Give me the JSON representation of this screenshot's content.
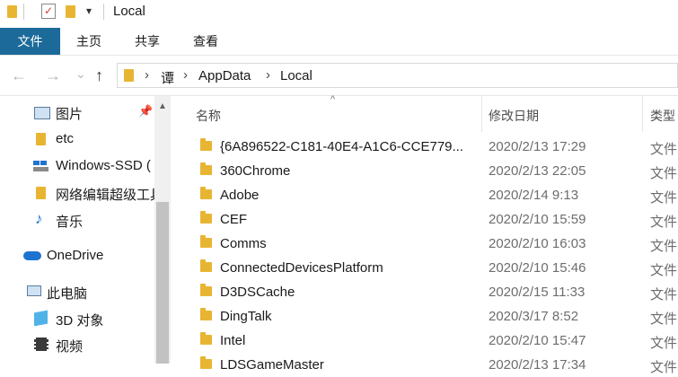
{
  "titlebar": {
    "title": "Local",
    "dropdown_glyph": "▾"
  },
  "ribbon": {
    "tabs": [
      "文件",
      "主页",
      "共享",
      "查看"
    ]
  },
  "address": {
    "back_glyph": "←",
    "forward_glyph": "→",
    "recent_glyph": "⌄",
    "up_glyph": "↑",
    "crumbs": [
      "谭",
      "AppData",
      "Local"
    ],
    "separator": "›"
  },
  "sidebar": {
    "items": [
      {
        "label": "图片",
        "icon": "pictures-icon",
        "pinned": true
      },
      {
        "label": "etc",
        "icon": "folder-icon"
      },
      {
        "label": "Windows-SSD (",
        "icon": "drive-icon"
      },
      {
        "label": "网络编辑超级工具",
        "icon": "folder-icon"
      },
      {
        "label": "音乐",
        "icon": "music-icon"
      },
      {
        "label": "OneDrive",
        "icon": "cloud-icon"
      },
      {
        "label": "此电脑",
        "icon": "computer-icon"
      },
      {
        "label": "3D 对象",
        "icon": "cube-icon"
      },
      {
        "label": "视频",
        "icon": "video-icon"
      }
    ]
  },
  "columns": {
    "name": "名称",
    "date": "修改日期",
    "type": "类型"
  },
  "files": [
    {
      "name": "{6A896522-C181-40E4-A1C6-CCE779...",
      "date": "2020/2/13 17:29",
      "type": "文件"
    },
    {
      "name": "360Chrome",
      "date": "2020/2/13 22:05",
      "type": "文件"
    },
    {
      "name": "Adobe",
      "date": "2020/2/14 9:13",
      "type": "文件"
    },
    {
      "name": "CEF",
      "date": "2020/2/10 15:59",
      "type": "文件"
    },
    {
      "name": "Comms",
      "date": "2020/2/10 16:03",
      "type": "文件"
    },
    {
      "name": "ConnectedDevicesPlatform",
      "date": "2020/2/10 15:46",
      "type": "文件"
    },
    {
      "name": "D3DSCache",
      "date": "2020/2/15 11:33",
      "type": "文件"
    },
    {
      "name": "DingTalk",
      "date": "2020/3/17 8:52",
      "type": "文件"
    },
    {
      "name": "Intel",
      "date": "2020/2/10 15:47",
      "type": "文件"
    },
    {
      "name": "LDSGameMaster",
      "date": "2020/2/13 17:34",
      "type": "文件"
    }
  ],
  "colors": {
    "file_tab": "#1c6a99",
    "folder": "#e8b533",
    "accent_blue": "#1e73d1"
  }
}
